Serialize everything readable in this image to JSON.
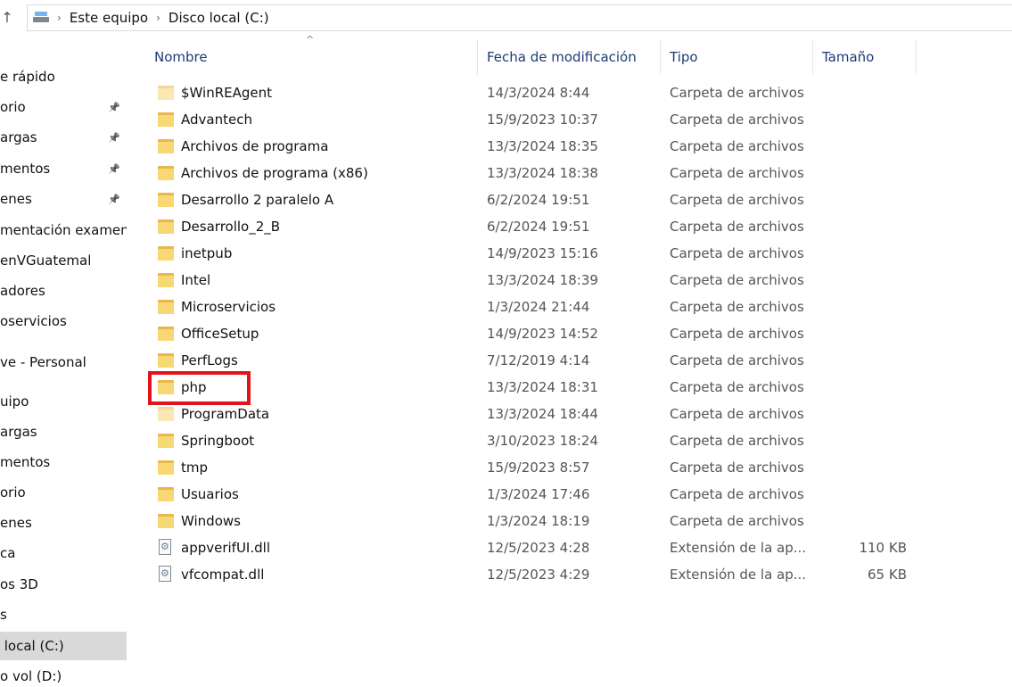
{
  "address": {
    "up_icon": "up-arrow-icon",
    "drive_icon": "this-pc-drive-icon",
    "crumbs": [
      "Este equipo",
      "Disco local (C:)"
    ]
  },
  "sidebar": {
    "items": [
      {
        "label": "e rápido",
        "pinned": false
      },
      {
        "label": "orio",
        "pinned": true
      },
      {
        "label": "argas",
        "pinned": true
      },
      {
        "label": "mentos",
        "pinned": true
      },
      {
        "label": "enes",
        "pinned": true
      },
      {
        "label": "mentación examen",
        "pinned": false
      },
      {
        "label": "enVGuatemal",
        "pinned": false
      },
      {
        "label": "adores",
        "pinned": false
      },
      {
        "label": "oservicios",
        "pinned": false
      },
      {
        "label": "ve - Personal",
        "pinned": false
      },
      {
        "label": "uipo",
        "pinned": false
      },
      {
        "label": "argas",
        "pinned": false
      },
      {
        "label": "mentos",
        "pinned": false
      },
      {
        "label": "orio",
        "pinned": false
      },
      {
        "label": "enes",
        "pinned": false
      },
      {
        "label": "ca",
        "pinned": false
      },
      {
        "label": "os 3D",
        "pinned": false
      },
      {
        "label": "s",
        "pinned": false
      },
      {
        "label": " local (C:)",
        "pinned": false,
        "selected": true
      },
      {
        "label": "o vol (D:)",
        "pinned": false
      }
    ]
  },
  "columns": {
    "name": "Nombre",
    "date": "Fecha de modificación",
    "type": "Tipo",
    "size": "Tamaño",
    "sort_icon": "sort-ascending-chevron-icon"
  },
  "files": [
    {
      "name": "$WinREAgent",
      "date": "14/3/2024 8:44",
      "type": "Carpeta de archivos",
      "size": "",
      "icon": "folder-icon",
      "faint": true
    },
    {
      "name": "Advantech",
      "date": "15/9/2023 10:37",
      "type": "Carpeta de archivos",
      "size": "",
      "icon": "folder-icon"
    },
    {
      "name": "Archivos de programa",
      "date": "13/3/2024 18:35",
      "type": "Carpeta de archivos",
      "size": "",
      "icon": "folder-icon"
    },
    {
      "name": "Archivos de programa (x86)",
      "date": "13/3/2024 18:38",
      "type": "Carpeta de archivos",
      "size": "",
      "icon": "folder-icon"
    },
    {
      "name": "Desarrollo 2 paralelo A",
      "date": "6/2/2024 19:51",
      "type": "Carpeta de archivos",
      "size": "",
      "icon": "folder-icon"
    },
    {
      "name": "Desarrollo_2_B",
      "date": "6/2/2024 19:51",
      "type": "Carpeta de archivos",
      "size": "",
      "icon": "folder-icon"
    },
    {
      "name": "inetpub",
      "date": "14/9/2023 15:16",
      "type": "Carpeta de archivos",
      "size": "",
      "icon": "folder-icon"
    },
    {
      "name": "Intel",
      "date": "13/3/2024 18:39",
      "type": "Carpeta de archivos",
      "size": "",
      "icon": "folder-icon"
    },
    {
      "name": "Microservicios",
      "date": "1/3/2024 21:44",
      "type": "Carpeta de archivos",
      "size": "",
      "icon": "folder-icon"
    },
    {
      "name": "OfficeSetup",
      "date": "14/9/2023 14:52",
      "type": "Carpeta de archivos",
      "size": "",
      "icon": "folder-icon"
    },
    {
      "name": "PerfLogs",
      "date": "7/12/2019 4:14",
      "type": "Carpeta de archivos",
      "size": "",
      "icon": "folder-icon"
    },
    {
      "name": "php",
      "date": "13/3/2024 18:31",
      "type": "Carpeta de archivos",
      "size": "",
      "icon": "folder-icon",
      "highlighted": true
    },
    {
      "name": "ProgramData",
      "date": "13/3/2024 18:44",
      "type": "Carpeta de archivos",
      "size": "",
      "icon": "folder-icon",
      "faint": true
    },
    {
      "name": "Springboot",
      "date": "3/10/2023 18:24",
      "type": "Carpeta de archivos",
      "size": "",
      "icon": "folder-icon"
    },
    {
      "name": "tmp",
      "date": "15/9/2023 8:57",
      "type": "Carpeta de archivos",
      "size": "",
      "icon": "folder-icon"
    },
    {
      "name": "Usuarios",
      "date": "1/3/2024 17:46",
      "type": "Carpeta de archivos",
      "size": "",
      "icon": "folder-icon"
    },
    {
      "name": "Windows",
      "date": "1/3/2024 18:19",
      "type": "Carpeta de archivos",
      "size": "",
      "icon": "folder-icon"
    },
    {
      "name": "appverifUI.dll",
      "date": "12/5/2023 4:28",
      "type": "Extensión de la ap...",
      "size": "110 KB",
      "icon": "dll-file-icon"
    },
    {
      "name": "vfcompat.dll",
      "date": "12/5/2023 4:29",
      "type": "Extensión de la ap...",
      "size": "65 KB",
      "icon": "dll-file-icon"
    }
  ],
  "colors": {
    "highlight_box": "#e0141a",
    "header_text": "#1e3a78",
    "selected_nav_bg": "#d9d9d9"
  }
}
